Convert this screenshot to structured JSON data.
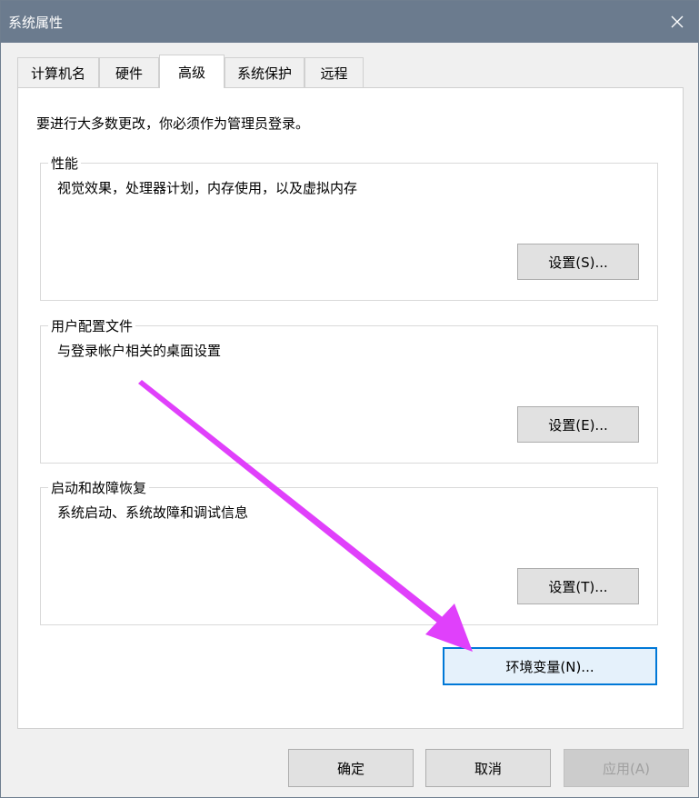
{
  "window": {
    "title": "系统属性"
  },
  "tabs": [
    {
      "label": "计算机名"
    },
    {
      "label": "硬件"
    },
    {
      "label": "高级"
    },
    {
      "label": "系统保护"
    },
    {
      "label": "远程"
    }
  ],
  "intro": "要进行大多数更改，你必须作为管理员登录。",
  "groups": {
    "performance": {
      "legend": "性能",
      "desc": "视觉效果，处理器计划，内存使用，以及虚拟内存",
      "button": "设置(S)..."
    },
    "profiles": {
      "legend": "用户配置文件",
      "desc": "与登录帐户相关的桌面设置",
      "button": "设置(E)..."
    },
    "startup": {
      "legend": "启动和故障恢复",
      "desc": "系统启动、系统故障和调试信息",
      "button": "设置(T)..."
    }
  },
  "env_button": "环境变量(N)...",
  "footer": {
    "ok": "确定",
    "cancel": "取消",
    "apply": "应用(A)"
  },
  "colors": {
    "titlebar": "#6b7b8e",
    "annotation_arrow": "#e040fb",
    "focus_border": "#0078d7"
  },
  "icons": {
    "close": "close-icon"
  }
}
